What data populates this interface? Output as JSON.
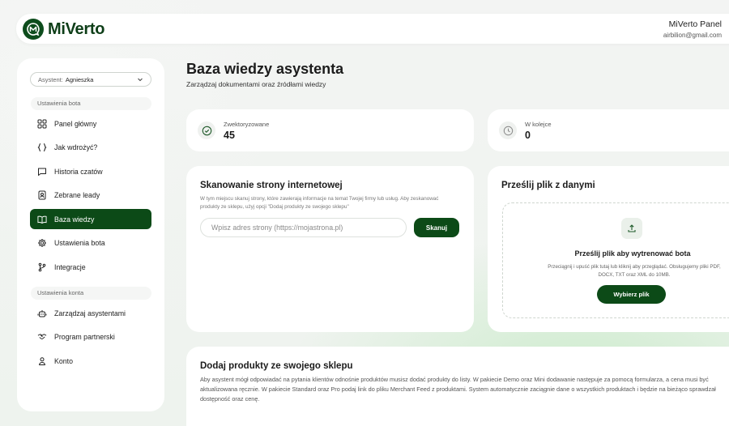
{
  "header": {
    "brand": "MiVerto",
    "user_name": "MiVerto Panel",
    "user_email": "airbilion@gmail.com"
  },
  "sidebar": {
    "assistant_prefix": "Asystent:",
    "assistant_value": "Agnieszka",
    "section_bot": "Ustawienia bota",
    "section_account": "Ustawienia konta",
    "bot_items": [
      {
        "label": "Panel główny",
        "icon": "grid-icon"
      },
      {
        "label": "Jak wdrożyć?",
        "icon": "code-braces-icon"
      },
      {
        "label": "Historia czatów",
        "icon": "chat-icon"
      },
      {
        "label": "Zebrane leady",
        "icon": "contacts-icon"
      },
      {
        "label": "Baza wiedzy",
        "icon": "book-icon",
        "active": true
      },
      {
        "label": "Ustawienia bota",
        "icon": "gear-icon"
      },
      {
        "label": "Integracje",
        "icon": "branch-icon"
      }
    ],
    "account_items": [
      {
        "label": "Zarządzaj asystentami",
        "icon": "robot-icon"
      },
      {
        "label": "Program partnerski",
        "icon": "handshake-icon"
      },
      {
        "label": "Konto",
        "icon": "user-icon"
      }
    ]
  },
  "main": {
    "title": "Baza wiedzy asystenta",
    "subtitle": "Zarządzaj dokumentami oraz źródłami wiedzy",
    "stats": [
      {
        "label": "Zwektoryzowane",
        "value": "45",
        "icon": "check-circle-icon"
      },
      {
        "label": "W kolejce",
        "value": "0",
        "icon": "clock-icon"
      }
    ],
    "scan": {
      "title": "Skanowanie strony internetowej",
      "description": "W tym miejscu skanuj strony, które zawierają informacje na temat Twojej firmy lub usług. Aby zeskanować produkty ze sklepu, użyj opcji \"Dodaj produkty ze swojego sklepu\"",
      "placeholder": "Wpisz adres strony (https://mojastrona.pl)",
      "button": "Skanuj"
    },
    "upload": {
      "title": "Prześlij plik z danymi",
      "drop_title": "Prześlij plik aby wytrenować bota",
      "drop_desc": "Przeciągnij i upuść plik tutaj lub kliknij aby przeglądać. Obsługujemy pliki PDF, DOCX, TXT oraz XML do 10MB.",
      "button": "Wybierz plik"
    },
    "shop": {
      "title": "Dodaj produkty ze swojego sklepu",
      "description": "Aby asystent mógł odpowiadać na pytania klientów odnośnie produktów musisz dodać produkty do listy. W pakiecie Demo oraz Mini dodawanie następuje za pomocą formularza, a cena musi być aktualizowana ręcznie. W pakiecie Standard oraz Pro podaj link do pliku Merchant Feed z produktami. System automatycznie zaciągnie dane o wszystkich produktach i będzie na bieżąco sprawdzał dostępność oraz cenę."
    }
  },
  "colors": {
    "accent": "#0c4a17",
    "background": "#eef2ef"
  }
}
